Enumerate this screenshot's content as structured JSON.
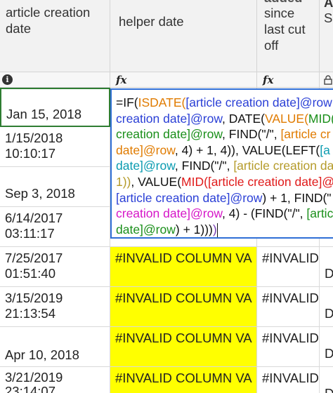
{
  "columns": {
    "col0": {
      "header_line1": "article creation",
      "header_line2": "date"
    },
    "col1": {
      "header": "helper date"
    },
    "col2": {
      "header_top": "added",
      "header_line1": "since",
      "header_line2": "last cut",
      "header_line3": "off"
    },
    "col3": {
      "header_line1": "A",
      "header_line2": "S"
    }
  },
  "icons": {
    "col0": "info-icon",
    "col1": "fx-icon",
    "col2": "fx-icon",
    "col3": "lock-icon"
  },
  "rows": [
    {
      "date_line1": "Jan 15, 2018",
      "date_line2": ""
    },
    {
      "date_line1": "1/15/2018",
      "date_line2": "10:10:17"
    },
    {
      "date_line1": "Sep 3, 2018",
      "date_line2": ""
    },
    {
      "date_line1": "6/14/2017",
      "date_line2": "03:11:17"
    },
    {
      "date_line1": "7/25/2017",
      "date_line2": "01:51:40",
      "helper": "#INVALID COLUMN VA",
      "since": "#INVALID",
      "extra": "D"
    },
    {
      "date_line1": "3/15/2019",
      "date_line2": "21:13:54",
      "helper": "#INVALID COLUMN VA",
      "since": "#INVALID",
      "extra": "D"
    },
    {
      "date_line1": "Apr 10, 2018",
      "date_line2": "",
      "helper": "#INVALID COLUMN VA",
      "since": "#INVALID",
      "extra": "D"
    },
    {
      "date_line1": "3/21/2019",
      "date_line2": "23:14:07",
      "helper": "#INVALID COLUMN VA",
      "since": "#INVALID",
      "extra": "D"
    }
  ],
  "formula_lines": [
    [
      [
        "fn",
        "=IF("
      ],
      [
        "orange",
        "ISDATE("
      ],
      [
        "blue",
        "[article creation date]@row"
      ]
    ],
    [
      [
        "blue",
        "creation date]@row"
      ],
      [
        "fn",
        ", DATE("
      ],
      [
        "orange",
        "VALUE("
      ],
      [
        "green",
        "MID("
      ]
    ],
    [
      [
        "green",
        "creation date]@row"
      ],
      [
        "fn",
        ", FIND(\"/\", "
      ],
      [
        "orange",
        "[article cr"
      ]
    ],
    [
      [
        "orange",
        "date]@row"
      ],
      [
        "fn",
        ", 4) + 1, 4)), VALUE(LEFT("
      ],
      [
        "teal",
        "[a"
      ]
    ],
    [
      [
        "teal",
        "date]@row"
      ],
      [
        "fn",
        ", FIND(\"/\", "
      ],
      [
        "olive",
        "[article creation da"
      ]
    ],
    [
      [
        "olive",
        "1))"
      ],
      [
        "fn",
        ", VALUE("
      ],
      [
        "red",
        "MID("
      ],
      [
        "red",
        "[article creation date]@"
      ]
    ],
    [
      [
        "blue",
        "[article creation date]@row"
      ],
      [
        "fn",
        ") + 1, FIND(\""
      ]
    ],
    [
      [
        "pink",
        "creation date]@row"
      ],
      [
        "fn",
        ", 4) - (FIND(\"/\", "
      ],
      [
        "green",
        "[artic"
      ]
    ],
    [
      [
        "green",
        "date]@row"
      ],
      [
        "fn",
        ") + 1)))"
      ],
      [
        "purple",
        ")"
      ]
    ]
  ]
}
